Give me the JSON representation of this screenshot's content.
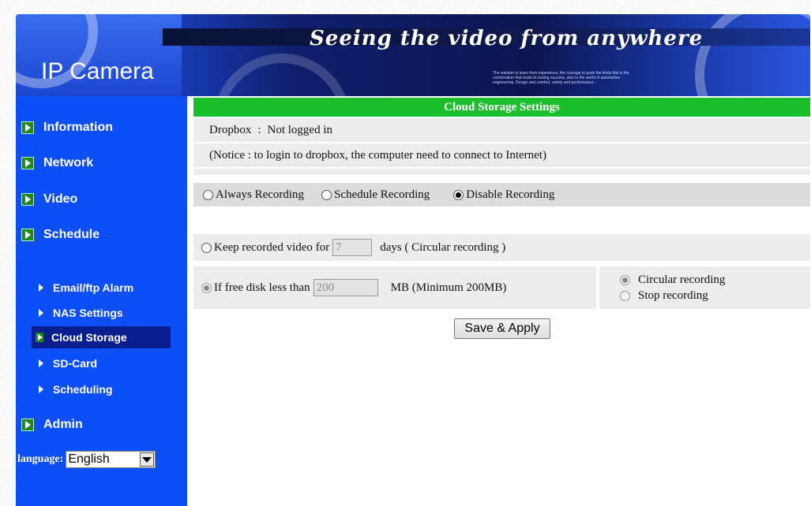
{
  "banner": {
    "tagline": "Seeing the video from anywhere",
    "brand": "IP Camera",
    "blurb": "The wisdom to learn from experience, the courage to push the limits this is the combination that leads to lasting success, also in the world of automotive engineering. Design and comfort, safety and performance..."
  },
  "sidebar": {
    "items": [
      {
        "label": "Information"
      },
      {
        "label": "Network"
      },
      {
        "label": "Video"
      },
      {
        "label": "Schedule"
      }
    ],
    "sub_items": [
      {
        "label": "Email/ftp Alarm"
      },
      {
        "label": "NAS Settings"
      },
      {
        "label": "Cloud Storage",
        "active": true
      },
      {
        "label": "SD-Card"
      },
      {
        "label": "Scheduling"
      }
    ],
    "admin": {
      "label": "Admin"
    },
    "language": {
      "label": "language:",
      "selected": "English"
    }
  },
  "main": {
    "title": "Cloud Storage Settings",
    "dropbox_label": "Dropbox",
    "dropbox_sep": ":",
    "dropbox_status": "Not logged in",
    "notice": "(Notice : to login to dropbox, the computer need to connect to Internet)",
    "recording_modes": [
      {
        "label": "Always Recording",
        "checked": false
      },
      {
        "label": "Schedule Recording",
        "checked": false
      },
      {
        "label": "Disable Recording",
        "checked": true
      }
    ],
    "keep": {
      "prefix": "Keep recorded video for",
      "value": "7",
      "suffix": "days ( Circular recording )"
    },
    "freedisk": {
      "prefix": "If free disk less than",
      "value": "200",
      "suffix": "MB (Minimum 200MB)"
    },
    "disk_full_options": [
      {
        "label": "Circular recording",
        "checked": true
      },
      {
        "label": "Stop recording",
        "checked": false
      }
    ],
    "save_button": "Save & Apply"
  },
  "colors": {
    "sidebar": "#0d4ff7",
    "header_green": "#1bbf2d",
    "active_item": "#0a1f8f"
  }
}
